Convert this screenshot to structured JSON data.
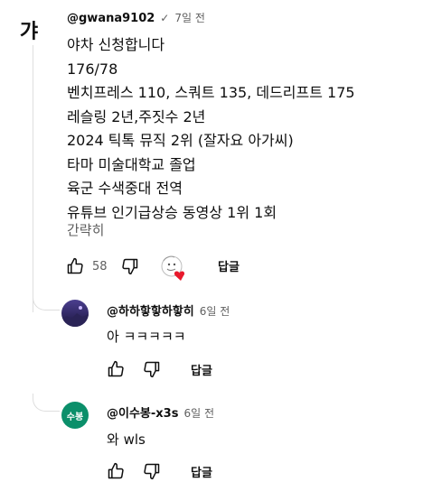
{
  "main_comment": {
    "avatar_text": "갸",
    "handle": "@gwana9102",
    "verified_mark": "✓",
    "time": "7일 전",
    "lines": [
      "야차 신청합니다",
      "176/78",
      "벤치프레스 110, 스쿼트 135, 데드리프트 175",
      "레슬링 2년,주짓수 2년",
      "2024 틱톡 뮤직 2위 (잘자요 아가씨)",
      "타마 미술대학교 졸업",
      "육군 수색중대 전역",
      "유튜브 인기급상승 동영상 1위 1회"
    ],
    "show_less": "간략히",
    "like_count": "58",
    "reply_label": "답글"
  },
  "replies": [
    {
      "handle": "@하하핳핳하핳히",
      "time": "6일 전",
      "text": "아 ㅋㅋㅋㅋㅋ",
      "reply_label": "답글",
      "avatar_color": "#3a3170"
    },
    {
      "handle": "@이수봉-x3s",
      "time": "6일 전",
      "text": "와 wls",
      "reply_label": "답글",
      "avatar_text": "수봉",
      "avatar_color": "#0b8f6a"
    }
  ],
  "icons": {
    "like": "thumbs-up-icon",
    "dislike": "thumbs-down-icon",
    "creator_heart": "creator-heart-icon"
  }
}
